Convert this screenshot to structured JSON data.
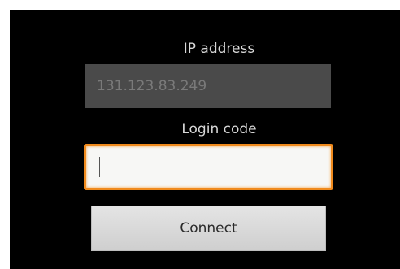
{
  "ip_address": {
    "label": "IP address",
    "value": "131.123.83.249"
  },
  "login_code": {
    "label": "Login code",
    "value": ""
  },
  "connect_button": {
    "label": "Connect"
  },
  "colors": {
    "background": "#000000",
    "focus_border": "#f08a1c",
    "disabled_field": "#4a4a4a"
  }
}
